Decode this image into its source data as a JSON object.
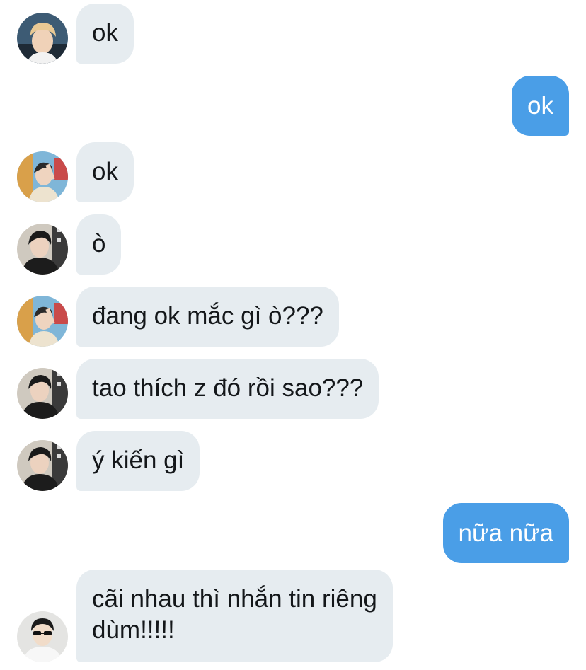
{
  "colors": {
    "incoming_bubble": "#e6ecf0",
    "outgoing_bubble": "#4a9ee7",
    "incoming_text": "#14171a",
    "outgoing_text": "#ffffff"
  },
  "messages": [
    {
      "direction": "incoming",
      "avatar": "user-a-avatar",
      "text": "ok"
    },
    {
      "direction": "outgoing",
      "text": "ok"
    },
    {
      "direction": "incoming",
      "avatar": "user-b-avatar",
      "text": "ok"
    },
    {
      "direction": "incoming",
      "avatar": "user-c-avatar",
      "text": "ò"
    },
    {
      "direction": "incoming",
      "avatar": "user-b-avatar",
      "text": "đang ok mắc gì ò???"
    },
    {
      "direction": "incoming",
      "avatar": "user-c-avatar",
      "text": "tao thích z đó rồi sao???"
    },
    {
      "direction": "incoming",
      "avatar": "user-c-avatar",
      "text": "ý kiến gì"
    },
    {
      "direction": "outgoing",
      "text": "nữa nữa"
    },
    {
      "direction": "incoming",
      "avatar": "user-d-avatar",
      "text_line1": "cãi nhau thì nhắn tin riêng",
      "text_line2": "dùm!!!!!"
    }
  ]
}
